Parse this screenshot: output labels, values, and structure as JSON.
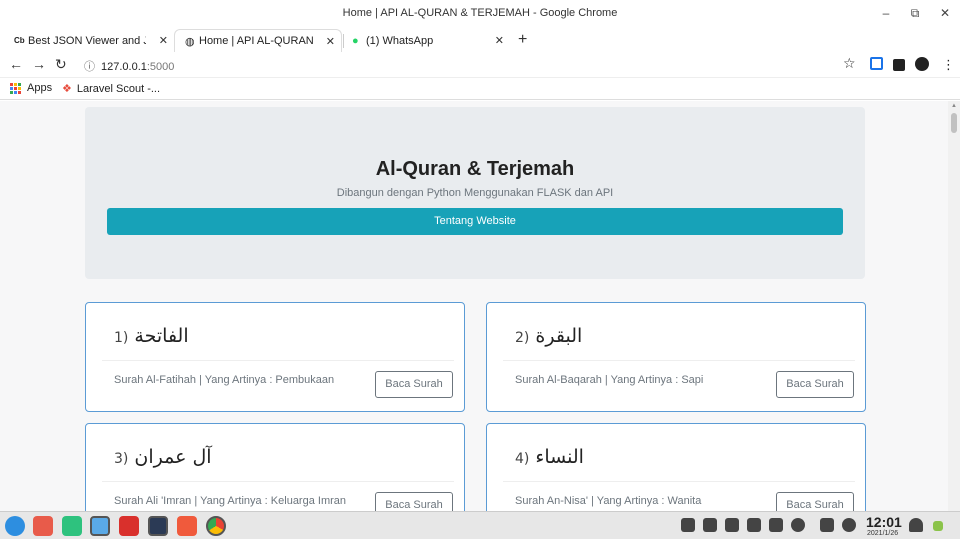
{
  "window": {
    "title": "Home | API AL-QURAN & TERJEMAH - Google Chrome",
    "minimize": "–",
    "maximize": "⧉",
    "close": "✕"
  },
  "tabs": [
    {
      "favicon": "Cb",
      "label": "Best JSON Viewer and JSO",
      "close": "✕"
    },
    {
      "favicon": "◍",
      "label": "Home | API AL-QURAN &",
      "close": "✕"
    },
    {
      "favicon": "●",
      "label": "(1) WhatsApp",
      "close": "✕"
    }
  ],
  "new_tab": "+",
  "toolbar": {
    "back": "←",
    "forward": "→",
    "reload": "↻",
    "url_host": "127.0.0.1",
    "url_port": ":5000",
    "info_icon": "ⓘ",
    "star": "☆",
    "menu": "⋮"
  },
  "bookmarks": [
    {
      "label": "Apps"
    },
    {
      "label": "Laravel Scout -..."
    }
  ],
  "hero": {
    "title": "Al-Quran & Terjemah",
    "subtitle": "Dibangun dengan Python Menggunakan FLASK dan API",
    "button": "Tentang Website"
  },
  "surahs": [
    {
      "number": "1)",
      "arabic": "الفاتحة",
      "desc": "Surah Al-Fatihah | Yang Artinya : Pembukaan",
      "button": "Baca Surah"
    },
    {
      "number": "2)",
      "arabic": "البقرة",
      "desc": "Surah Al-Baqarah | Yang Artinya : Sapi",
      "button": "Baca Surah"
    },
    {
      "number": "3)",
      "arabic": "آل عمران",
      "desc": "Surah Ali 'Imran | Yang Artinya : Keluarga Imran",
      "button": "Baca Surah"
    },
    {
      "number": "4)",
      "arabic": "النساء",
      "desc": "Surah An-Nisa' | Yang Artinya : Wanita",
      "button": "Baca Surah"
    }
  ],
  "taskbar": {
    "time": "12:01",
    "date": "2021/1/26"
  },
  "colors": {
    "accent": "#17a2b8",
    "card_border": "#5b9bd5",
    "jumbotron": "#e9ecef"
  }
}
